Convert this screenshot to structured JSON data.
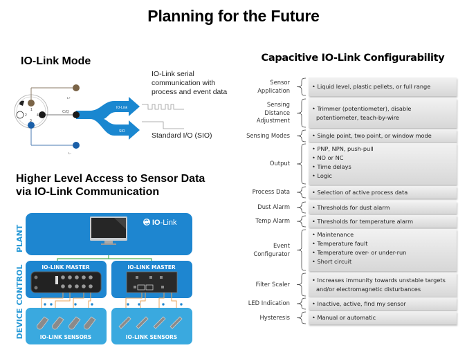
{
  "page": {
    "title": "Planning for the Future"
  },
  "left": {
    "iolink_mode": {
      "title": "IO-Link Mode",
      "serial_label_lines": [
        "IO-Link serial",
        "communication  with",
        "process and event data"
      ],
      "sio_label": "Standard I/O  (SIO)",
      "arrow_iolink_label": "IO-Link",
      "arrow_sio_label": "SIO",
      "pin_labels": [
        "1",
        "2",
        "3",
        "4"
      ],
      "wire_labels": {
        "l_plus": "L+",
        "cq": "C/Q",
        "l_minus": "L-"
      },
      "colors": {
        "arrow": "#1a87d0",
        "pin_brown": "#7a6447",
        "pin_black": "#1a1a1a",
        "pin_blue": "#1a5fa8"
      }
    },
    "access": {
      "title_lines": [
        "Higher Level Access to Sensor Data",
        "via IO-Link Communication"
      ],
      "brand": {
        "strong": "IO",
        "rest": "-Link"
      },
      "levels": [
        "PLANT",
        "CONTROL",
        "DEVICE"
      ],
      "masters": [
        "IO-LINK MASTER",
        "IO-LINK MASTER"
      ],
      "sensors": [
        "IO-LINK SENSORS",
        "IO-LINK SENSORS"
      ],
      "colors": {
        "plant": "#1e86d0",
        "panel": "#2a9ad6",
        "device": "#3aa9df",
        "label": "#2a9ad6",
        "network": "#4caf50",
        "cable": "#e8a35a"
      }
    }
  },
  "right": {
    "title": "Capacitive IO-Link Configurability",
    "rows": [
      {
        "label_lines": [
          "Sensor",
          "Application"
        ],
        "items": [
          "Liquid level, plastic pellets, or full range"
        ]
      },
      {
        "label_lines": [
          "Sensing",
          "Distance",
          "Adjustment"
        ],
        "items": [
          "Trimmer (potentiometer), disable potentiometer, teach-by-wire"
        ]
      },
      {
        "label_lines": [
          "Sensing Modes"
        ],
        "items": [
          "Single point, two point, or window mode"
        ]
      },
      {
        "label_lines": [
          "Output"
        ],
        "items": [
          "PNP, NPN, push-pull",
          "NO or NC",
          "Time delays",
          "Logic"
        ]
      },
      {
        "label_lines": [
          "Process Data"
        ],
        "items": [
          "Selection of active process data"
        ]
      },
      {
        "label_lines": [
          "Dust Alarm"
        ],
        "items": [
          "Thresholds for dust alarm"
        ]
      },
      {
        "label_lines": [
          "Temp Alarm"
        ],
        "items": [
          "Thresholds for temperature alarm"
        ]
      },
      {
        "label_lines": [
          "Event",
          "Configurator"
        ],
        "items": [
          "Maintenance",
          "Temperature fault",
          "Temperature over- or under-run",
          "Short circuit"
        ]
      },
      {
        "label_lines": [
          "Filter Scaler"
        ],
        "items": [
          "Increases immunity towards unstable targets and/or electromagnetic disturbances"
        ]
      },
      {
        "label_lines": [
          "LED Indication"
        ],
        "items": [
          "Inactive, active, find my sensor"
        ]
      },
      {
        "label_lines": [
          "Hysteresis"
        ],
        "items": [
          "Manual or automatic"
        ]
      }
    ]
  }
}
